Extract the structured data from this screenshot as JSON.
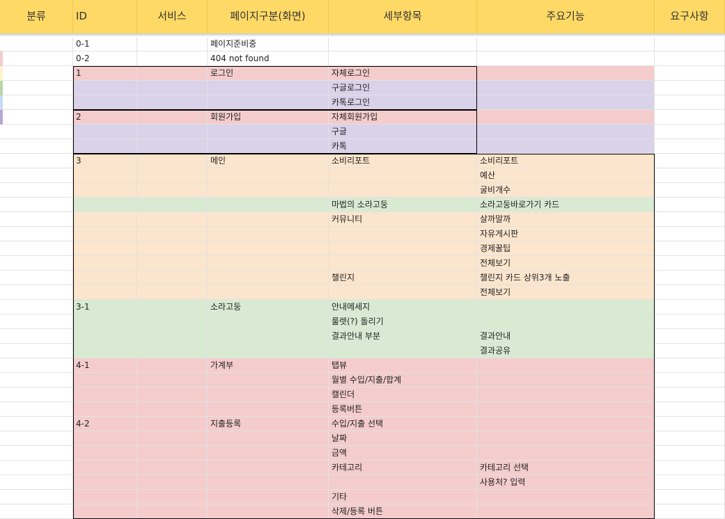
{
  "colors": {
    "header": "#ffd966",
    "pink": "#f4cccc",
    "lavender": "#d9d2e9",
    "peach": "#fce5cd",
    "green": "#d9ead3",
    "white": "#ffffff"
  },
  "headers": [
    "분류",
    "ID",
    "서비스",
    "페이지구분(화면)",
    "세부항목",
    "주요기능",
    "요구사항"
  ],
  "rows": [
    {
      "id": "0-1",
      "page": "페이지준비중",
      "detail": "",
      "func": ""
    },
    {
      "id": "0-2",
      "page": "404 not found",
      "detail": "",
      "func": ""
    },
    {
      "id": "1",
      "page": "로그인",
      "detail": "자체로그인",
      "func": ""
    },
    {
      "id": "",
      "page": "",
      "detail": "구글로그인",
      "func": ""
    },
    {
      "id": "",
      "page": "",
      "detail": "카톡로그인",
      "func": ""
    },
    {
      "id": "2",
      "page": "회원가입",
      "detail": "자체회원가입",
      "func": ""
    },
    {
      "id": "",
      "page": "",
      "detail": "구글",
      "func": ""
    },
    {
      "id": "",
      "page": "",
      "detail": "카톡",
      "func": ""
    },
    {
      "id": "3",
      "page": "메인",
      "detail": "소비리포트",
      "func": "소비리포트"
    },
    {
      "id": "",
      "page": "",
      "detail": "",
      "func": "예산"
    },
    {
      "id": "",
      "page": "",
      "detail": "",
      "func": "굴비개수"
    },
    {
      "id": "",
      "page": "",
      "detail": "마법의 소라고둥",
      "func": "소라고둥바로가기 카드"
    },
    {
      "id": "",
      "page": "",
      "detail": "커뮤니티",
      "func": "살까말까"
    },
    {
      "id": "",
      "page": "",
      "detail": "",
      "func": "자유게시판"
    },
    {
      "id": "",
      "page": "",
      "detail": "",
      "func": "경제꿀팁"
    },
    {
      "id": "",
      "page": "",
      "detail": "",
      "func": "전체보기"
    },
    {
      "id": "",
      "page": "",
      "detail": "챌린지",
      "func": "챌린지 카드 상위3개 노출"
    },
    {
      "id": "",
      "page": "",
      "detail": "",
      "func": "전체보기"
    },
    {
      "id": "3-1",
      "page": "소라고둥",
      "detail": "안내메세지",
      "func": ""
    },
    {
      "id": "",
      "page": "",
      "detail": "룰렛(?) 돌리기",
      "func": ""
    },
    {
      "id": "",
      "page": "",
      "detail": "결과안내 부분",
      "func": "결과안내"
    },
    {
      "id": "",
      "page": "",
      "detail": "",
      "func": "결과공유"
    },
    {
      "id": "4-1",
      "page": "가계부",
      "detail": "탭뷰",
      "func": ""
    },
    {
      "id": "",
      "page": "",
      "detail": "월별 수입/지출/합계",
      "func": ""
    },
    {
      "id": "",
      "page": "",
      "detail": "캘린더",
      "func": ""
    },
    {
      "id": "",
      "page": "",
      "detail": "등록버튼",
      "func": ""
    },
    {
      "id": "4-2",
      "page": "지출등록",
      "detail": "수입/지출 선택",
      "func": ""
    },
    {
      "id": "",
      "page": "",
      "detail": "날짜",
      "func": ""
    },
    {
      "id": "",
      "page": "",
      "detail": "금액",
      "func": ""
    },
    {
      "id": "",
      "page": "",
      "detail": "카테고리",
      "func": "카테고리 선택"
    },
    {
      "id": "",
      "page": "",
      "detail": "",
      "func": "사용처? 입력"
    },
    {
      "id": "",
      "page": "",
      "detail": "기타",
      "func": ""
    },
    {
      "id": "",
      "page": "",
      "detail": "삭제/등록 버튼",
      "func": ""
    }
  ]
}
